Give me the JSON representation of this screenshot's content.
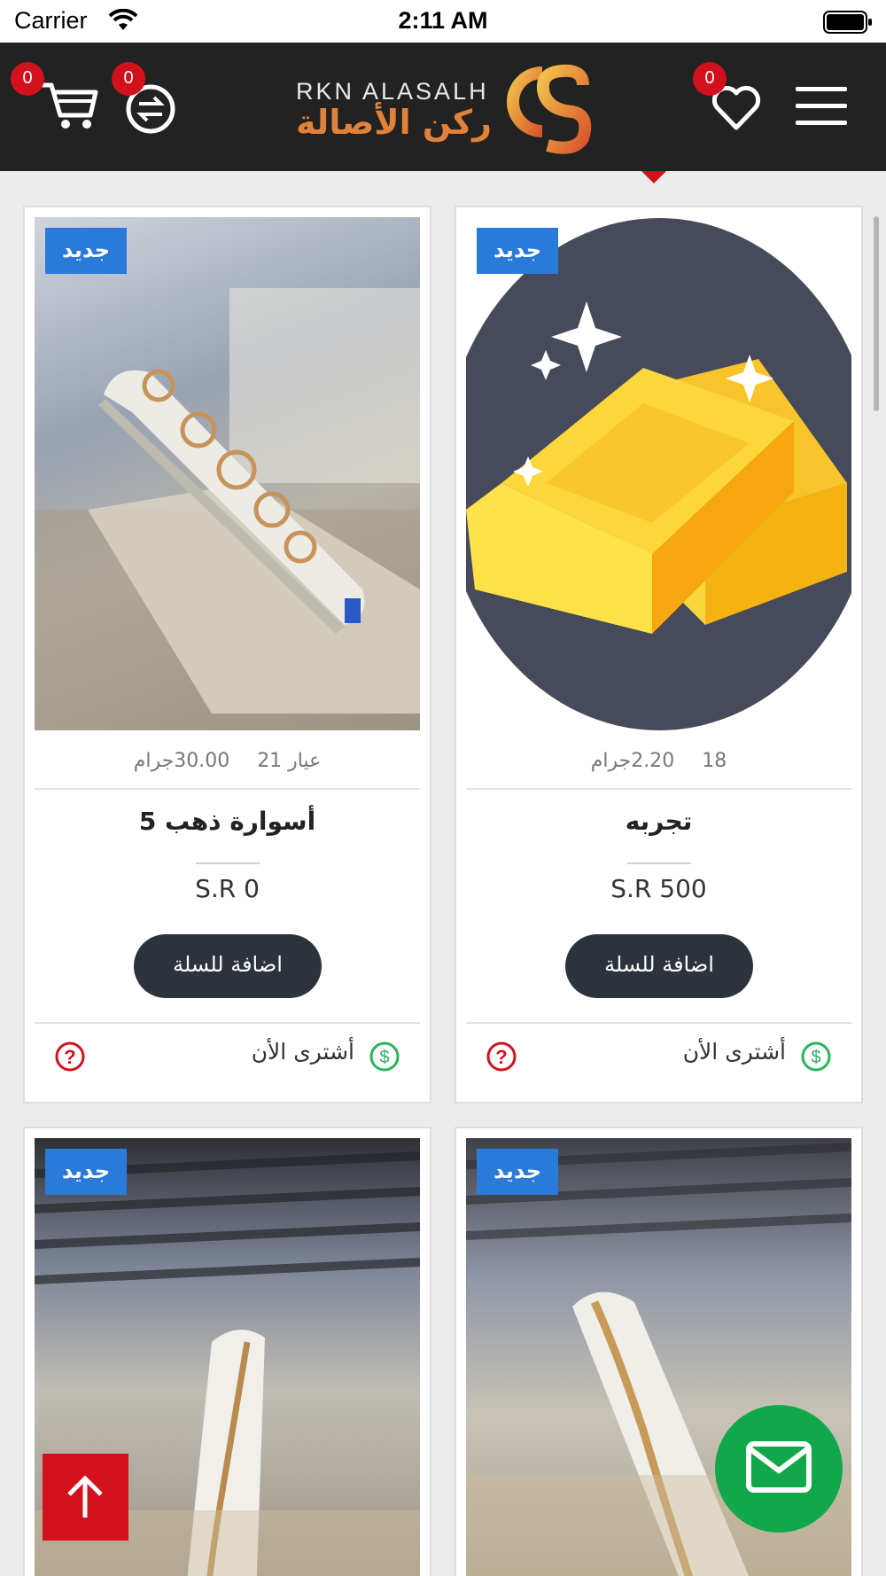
{
  "status_bar": {
    "carrier": "Carrier",
    "time": "2:11 AM"
  },
  "header": {
    "cart_count": "0",
    "compare_count": "0",
    "wishlist_count": "0",
    "logo_en": "RKN ALASALH",
    "logo_ar": "ركن الأصالة",
    "accent_color": "#d2111d",
    "background_color": "#222222"
  },
  "products": [
    {
      "tag": "جديد",
      "karat": "18",
      "weight": "2.20جرام",
      "name": "تجربه",
      "price": "S.R 500",
      "add_to_cart": "اضافة للسلة",
      "buy_now": "أشترى الأن",
      "image": "gold-bars-illustration"
    },
    {
      "tag": "جديد",
      "karat": "عيار 21",
      "weight": "30.00جرام",
      "name": "أسوارة ذهب 5",
      "price": "S.R 0",
      "add_to_cart": "اضافة للسلة",
      "buy_now": "أشترى الأن",
      "image": "gold-bracelet-photo"
    },
    {
      "tag": "جديد",
      "image": "gold-bracelet-photo"
    },
    {
      "tag": "جديد",
      "image": "gold-bracelet-photo"
    }
  ],
  "colors": {
    "new_tag": "#2a7ad9",
    "cart_button": "#2d333c",
    "mail_fab": "#10a84a",
    "top_fab": "#d2111d",
    "buy_icon": "#2bb45a",
    "help_icon": "#d2111d"
  }
}
